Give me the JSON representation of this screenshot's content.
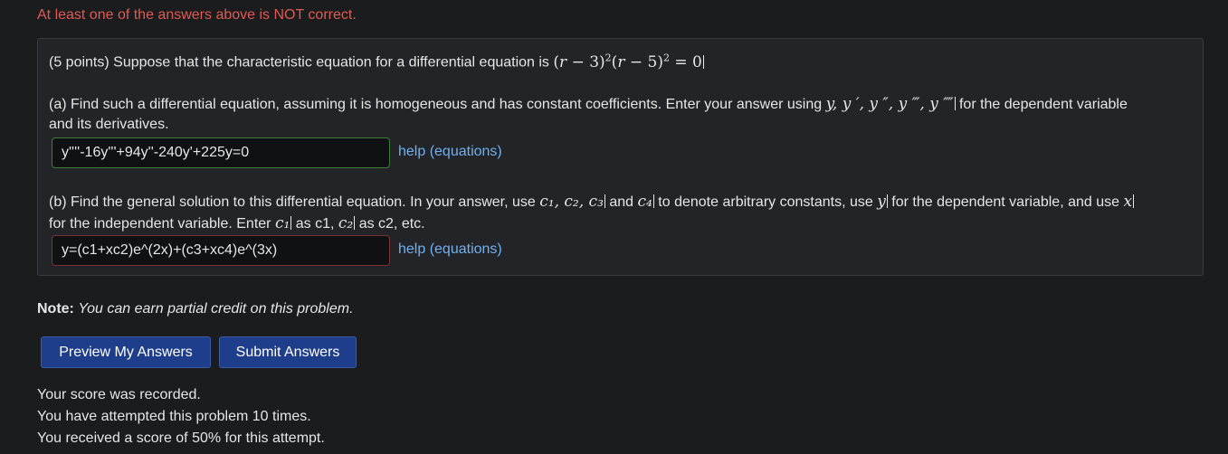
{
  "alert_text": "At least one of the answers above is NOT correct.",
  "problem": {
    "intro": "(5 points) Suppose that the characteristic equation for a differential equation is",
    "char_eq": {
      "p1_open": "(",
      "p1_var": "r",
      "p1_rest": " − 3)",
      "p1_exp": "2",
      "p2_open": "(",
      "p2_var": "r",
      "p2_rest": " − 5)",
      "p2_exp": "2",
      "eq": " = 0"
    },
    "part_a": {
      "line1_pre": "(a) Find such a differential equation, assuming it is homogeneous and has constant coefficients. Enter your answer using",
      "vars": "y, y ′, y ″, y ‴, y ⁗",
      "line1_post": "for the dependent variable",
      "line2": "and its derivatives.",
      "answer_value": "y''''-16y'''+94y''-240y'+225y=0",
      "help_label": "help (equations)"
    },
    "part_b": {
      "line1_pre": "(b) Find the general solution to this differential equation. In your answer, use",
      "consts": "c₁, c₂, c₃",
      "and_word": "and",
      "c4": "c₄",
      "line1_mid": "to denote arbitrary constants, use",
      "yvar": "y",
      "line1_mid2": "for the dependent variable, and use",
      "xvar": "x",
      "line2_pre": "for the independent variable. Enter",
      "c1": "c₁",
      "as_c1": "as c1,",
      "c2": "c₂",
      "as_c2": "as c2, etc.",
      "answer_value": "y=(c1+xc2)e^(2x)+(c3+xc4)e^(3x)",
      "help_label": "help (equations)"
    }
  },
  "note": {
    "label": "Note:",
    "text": "You can earn partial credit on this problem."
  },
  "buttons": {
    "preview": "Preview My Answers",
    "submit": "Submit Answers"
  },
  "score_messages": [
    "Your score was recorded.",
    "You have attempted this problem 10 times.",
    "You received a score of 50% for this attempt."
  ],
  "colors": {
    "background": "#1b1c1e",
    "alert": "#e05a55",
    "link": "#6fb0ef",
    "button": "#1e3d8a",
    "correct_border": "#3f7d3a",
    "incorrect_border": "#7a3434"
  }
}
